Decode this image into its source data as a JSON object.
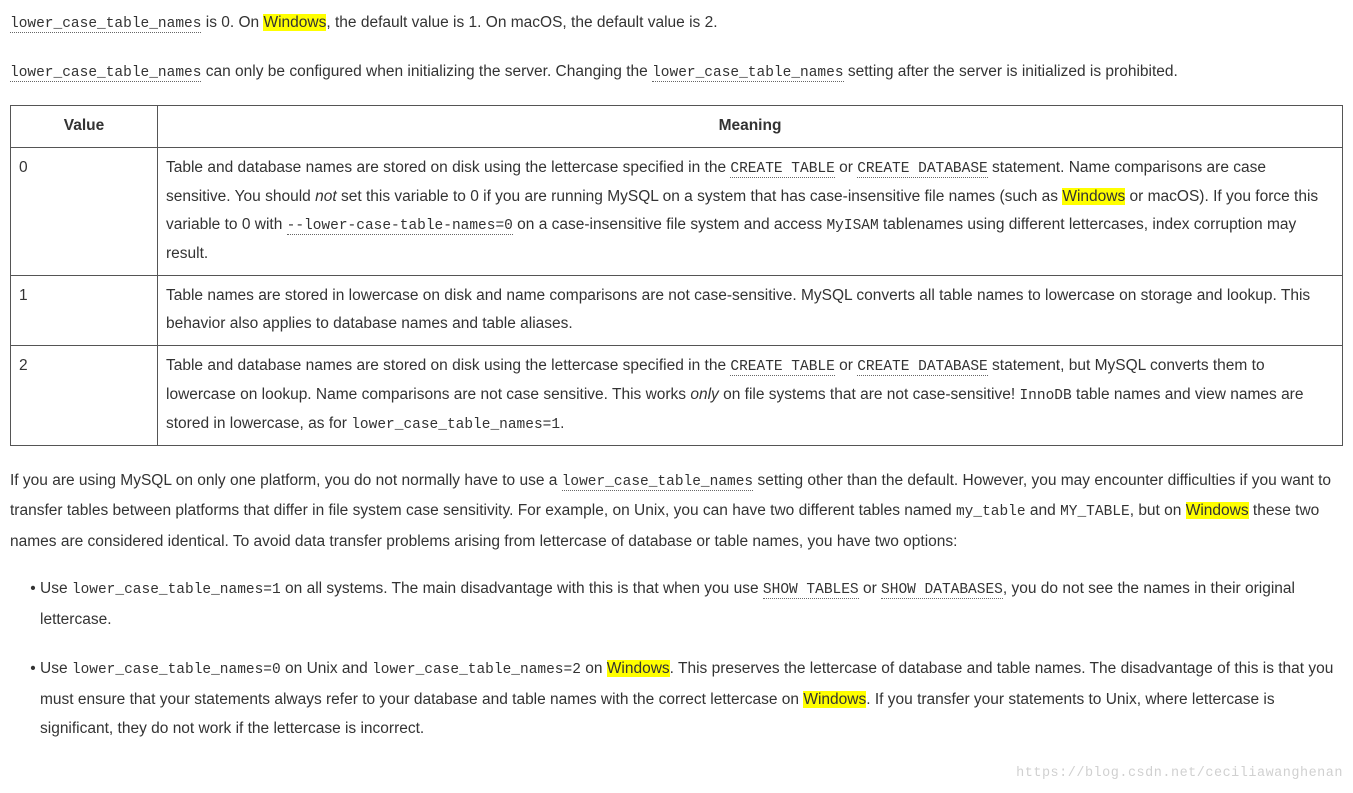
{
  "p1": {
    "a": "lower_case_table_names",
    "b": " is 0. On ",
    "c": "Windows",
    "d": ", the default value is 1. On macOS, the default value is 2."
  },
  "p2": {
    "a": "lower_case_table_names",
    "b": " can only be configured when initializing the server. Changing the ",
    "c": "lower_case_table_names",
    "d": " setting after the server is initialized is prohibited."
  },
  "table": {
    "h0": "Value",
    "h1": "Meaning",
    "r0v": "0",
    "r0": {
      "a": "Table and database names are stored on disk using the lettercase specified in the ",
      "b": "CREATE TABLE",
      "c": " or ",
      "d": "CREATE DATABASE",
      "e": " statement. Name comparisons are case sensitive. You should ",
      "f": "not",
      "g": " set this variable to 0 if you are running MySQL on a system that has case-insensitive file names (such as ",
      "h": "Windows",
      "i": " or macOS). If you force this variable to 0 with ",
      "j": "--lower-case-table-names=0",
      "k": " on a case-insensitive file system and access ",
      "l": "MyISAM",
      "m": " tablenames using different lettercases, index corruption may result."
    },
    "r1v": "1",
    "r1": "Table names are stored in lowercase on disk and name comparisons are not case-sensitive. MySQL converts all table names to lowercase on storage and lookup. This behavior also applies to database names and table aliases.",
    "r2v": "2",
    "r2": {
      "a": "Table and database names are stored on disk using the lettercase specified in the ",
      "b": "CREATE TABLE",
      "c": " or ",
      "d": "CREATE DATABASE",
      "e": " statement, but MySQL converts them to lowercase on lookup. Name comparisons are not case sensitive. This works ",
      "f": "only",
      "g": " on file systems that are not case-sensitive! ",
      "h": "InnoDB",
      "i": " table names and view names are stored in lowercase, as for ",
      "j": "lower_case_table_names=1",
      "k": "."
    }
  },
  "p3": {
    "a": "If you are using MySQL on only one platform, you do not normally have to use a ",
    "b": "lower_case_table_names",
    "c": " setting other than the default. However, you may encounter difficulties if you want to transfer tables between platforms that differ in file system case sensitivity. For example, on Unix, you can have two different tables named ",
    "d": "my_table",
    "e": " and ",
    "f": "MY_TABLE",
    "g": ", but on ",
    "h": "Windows",
    "i": " these two names are considered identical. To avoid data transfer problems arising from lettercase of database or table names, you have two options:"
  },
  "li1": {
    "a": "Use ",
    "b": "lower_case_table_names=1",
    "c": " on all systems. The main disadvantage with this is that when you use ",
    "d": "SHOW TABLES",
    "e": " or ",
    "f": "SHOW DATABASES",
    "g": ", you do not see the names in their original lettercase."
  },
  "li2": {
    "a": "Use ",
    "b": "lower_case_table_names=0",
    "c": " on Unix and ",
    "d": "lower_case_table_names=2",
    "e": " on ",
    "f": "Windows",
    "g": ". This preserves the lettercase of database and table names. The disadvantage of this is that you must ensure that your statements always refer to your database and table names with the correct lettercase on ",
    "h": "Windows",
    "i": ". If you transfer your statements to Unix, where lettercase is significant, they do not work if the lettercase is incorrect."
  },
  "watermark": "https://blog.csdn.net/ceciliawanghenan"
}
